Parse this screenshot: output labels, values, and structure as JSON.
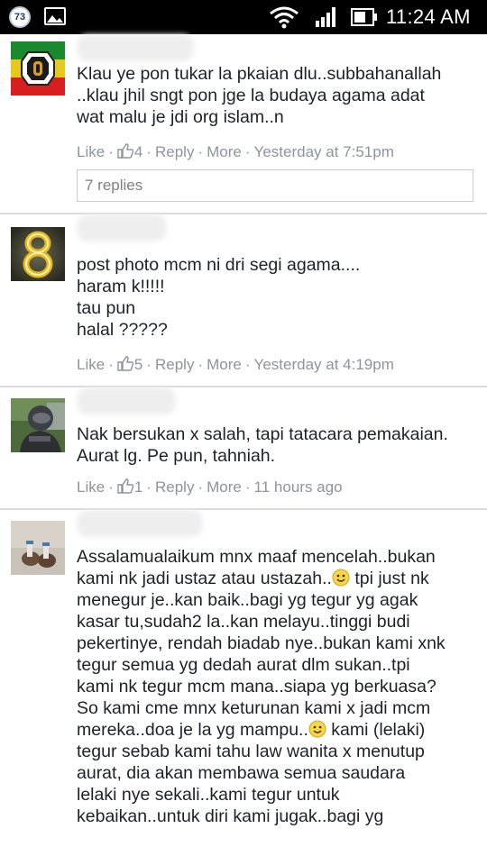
{
  "status_bar": {
    "notification_count": "73",
    "time": "11:24 AM"
  },
  "comments": [
    {
      "text": "Klau ye pon tukar la pkaian dlu..subbahanallah\n..klau jhil sngt pon jge la budaya agama adat\nwat malu je jdi org islam..n",
      "like": "Like",
      "like_count": "4",
      "reply": "Reply",
      "more": "More",
      "time": "Yesterday at 7:51pm",
      "replies": "7 replies"
    },
    {
      "text": "post photo mcm ni dri segi agama....\nharam k!!!!!\ntau pun\nhalal ?????",
      "like": "Like",
      "like_count": "5",
      "reply": "Reply",
      "more": "More",
      "time": "Yesterday at 4:19pm"
    },
    {
      "text": "Nak bersukan x salah, tapi tatacara pemakaian.\nAurat lg. Pe pun, tahniah.",
      "like": "Like",
      "like_count": "1",
      "reply": "Reply",
      "more": "More",
      "time": "11 hours ago"
    },
    {
      "text_lines": [
        {
          "a": "Assalamualaikum mnx maaf mencelah..bukan"
        },
        {
          "a": "kami nk jadi ustaz atau ustazah..",
          "emoji": "smile",
          "b": " tpi just nk"
        },
        {
          "a": "menegur je..kan baik..bagi yg tegur yg agak"
        },
        {
          "a": "kasar tu,sudah2 la..kan melayu..tinggi budi"
        },
        {
          "a": "pekertinye, rendah biadab nye..bukan kami xnk"
        },
        {
          "a": "tegur semua yg dedah aurat dlm sukan..tpi"
        },
        {
          "a": "kami nk tegur mcm mana..siapa yg berkuasa?"
        },
        {
          "a": "So kami cme mnx keturunan kami x jadi mcm"
        },
        {
          "a": "mereka..doa je la yg mampu..",
          "emoji": "smile",
          "b": " kami (lelaki)"
        },
        {
          "a": "tegur sebab kami tahu law wanita x menutup"
        },
        {
          "a": "aurat, dia akan membawa semua saudara"
        },
        {
          "a": "lelaki nye sekali..kami tegur untuk"
        },
        {
          "a": "kebaikan..untuk diri kami jugak..bagi yg"
        }
      ]
    }
  ],
  "icons": {
    "notification_badge": "circle-number",
    "gallery": "image-icon",
    "wifi": "wifi-icon",
    "signal": "signal-icon",
    "battery": "battery-icon",
    "like": "thumbs-up-icon",
    "emoji": "smiley-icon"
  },
  "colors": {
    "meta_text": "#8d949e",
    "body_text": "#1d2129",
    "divider": "#d8dbe2"
  }
}
